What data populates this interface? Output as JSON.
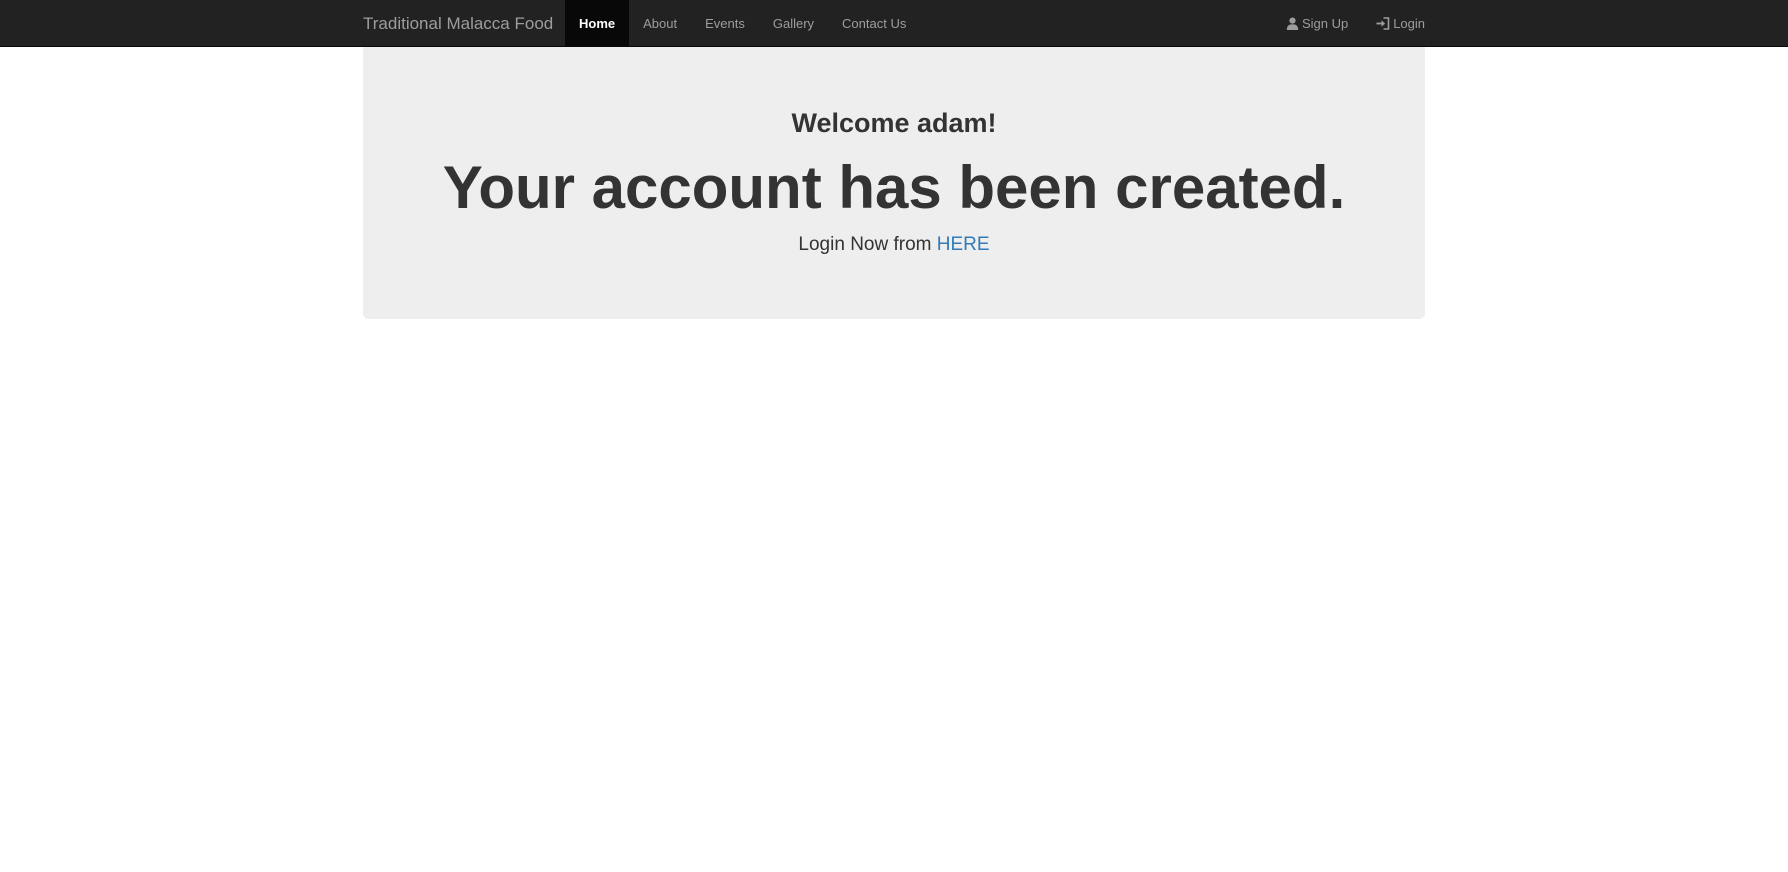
{
  "navbar": {
    "brand": "Traditional Malacca Food",
    "items": [
      {
        "label": "Home",
        "active": true
      },
      {
        "label": "About"
      },
      {
        "label": "Events"
      },
      {
        "label": "Gallery"
      },
      {
        "label": "Contact Us"
      }
    ],
    "right_items": [
      {
        "label": "Sign Up",
        "icon": "user-icon"
      },
      {
        "label": "Login",
        "icon": "login-icon"
      }
    ],
    "colors": {
      "background": "#222222",
      "text": "#9d9d9d",
      "active_background": "#080808",
      "active_text": "#ffffff"
    }
  },
  "jumbotron": {
    "welcome": "Welcome adam!",
    "headline": "Your account has been created.",
    "login_prefix": "Login Now from",
    "login_link": "HERE",
    "colors": {
      "background": "#eeeeee",
      "link": "#337ab7"
    }
  }
}
